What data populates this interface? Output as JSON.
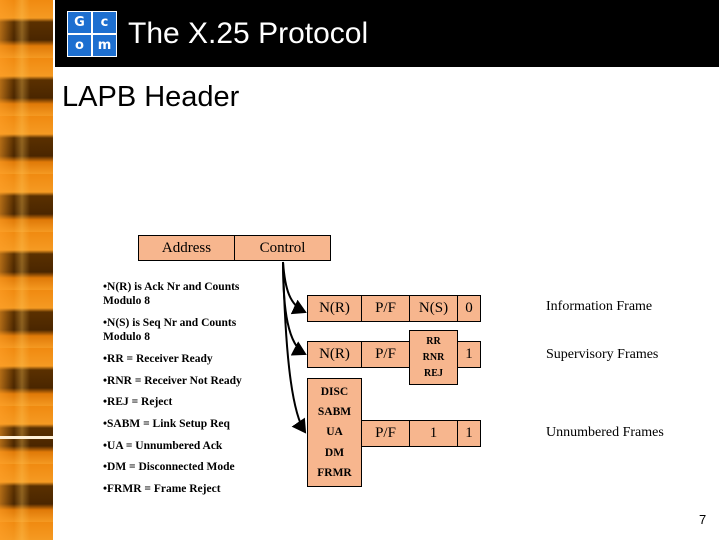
{
  "header": {
    "logo_letters": [
      "G",
      "c",
      "o",
      "m"
    ],
    "title": "The X.25 Protocol"
  },
  "slide": {
    "heading": "LAPB Header",
    "page_number": "7"
  },
  "header_fields": {
    "address": "Address",
    "control": "Control"
  },
  "notes": [
    "•N(R) is Ack Nr and Counts",
    "Modulo 8",
    "•N(S) is Seq Nr and Counts",
    "Modulo 8",
    "•RR = Receiver Ready",
    "•RNR = Receiver Not Ready",
    "•REJ = Reject",
    "•SABM = Link Setup Req",
    "•UA = Unnumbered Ack",
    "•DM = Disconnected Mode",
    "•FRMR = Frame Reject"
  ],
  "frames": {
    "information": {
      "fields": [
        "N(R)",
        "P/F",
        "N(S)",
        "0"
      ],
      "label": "Information Frame"
    },
    "supervisory": {
      "fields": [
        "N(R)",
        "P/F",
        "",
        "1"
      ],
      "types": [
        "RR",
        "RNR",
        "REJ"
      ],
      "label": "Supervisory Frames"
    },
    "unnumbered": {
      "types": [
        "DISC",
        "SABM",
        "UA",
        "DM",
        "FRMR"
      ],
      "fields": [
        "P/F",
        "1",
        "1"
      ],
      "label": "Unnumbered Frames"
    }
  },
  "colors": {
    "field_fill": "#f7b68e",
    "title_bar": "#000000",
    "logo_blue": "#1d6fd0",
    "strip_orange": "#f08a10"
  }
}
